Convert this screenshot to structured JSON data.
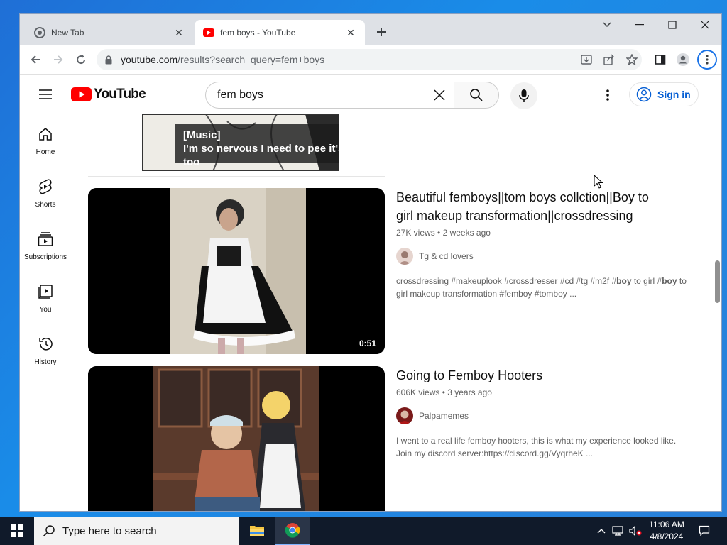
{
  "browser": {
    "tabs": [
      {
        "title": "New Tab",
        "favicon": "chrome-icon"
      },
      {
        "title": "fem boys - YouTube",
        "favicon": "youtube-icon"
      }
    ],
    "url_host": "youtube.com",
    "url_path": "/results?search_query=fem+boys"
  },
  "youtube": {
    "logo": "YouTube",
    "search_query": "fem boys",
    "sign_in_label": "Sign in",
    "guide": [
      {
        "label": "Home",
        "icon": "home-icon"
      },
      {
        "label": "Shorts",
        "icon": "shorts-icon"
      },
      {
        "label": "Subscriptions",
        "icon": "subscriptions-icon"
      },
      {
        "label": "You",
        "icon": "you-icon"
      },
      {
        "label": "History",
        "icon": "history-icon"
      }
    ],
    "previous_caption": [
      "[Music]",
      "I'm so nervous I need to pee it's too"
    ],
    "videos": [
      {
        "title_line1": "Beautiful femboys||tom boys collction||Boy to",
        "title_line2": "girl makeup transformation||crossdressing",
        "views": "27K views",
        "age": "2 weeks ago",
        "channel": "Tg & cd lovers",
        "desc_line1_a": "crossdressing #makeuplook #crossdresser #cd #tg #m2f #",
        "desc_bold1": "boy",
        "desc_line1_b": " to girl #",
        "desc_bold2": "boy",
        "desc_line1_c": " to",
        "desc_line2": "girl makeup transformation #femboy #tomboy ...",
        "duration": "0:51"
      },
      {
        "title_line1": "Going to Femboy Hooters",
        "views": "606K views",
        "age": "3 years ago",
        "channel": "Palpamemes",
        "desc_line1": "I went to a real life femboy hooters, this is what my experience looked like.",
        "desc_line2": "Join my discord server:https://discord.gg/VyqrheK ..."
      }
    ]
  },
  "taskbar": {
    "search_placeholder": "Type here to search",
    "time": "11:06 AM",
    "date": "4/8/2024"
  },
  "colors": {
    "youtube_red": "#ff0000",
    "link_blue": "#065fd4",
    "taskbar_bg": "#101a2a"
  }
}
